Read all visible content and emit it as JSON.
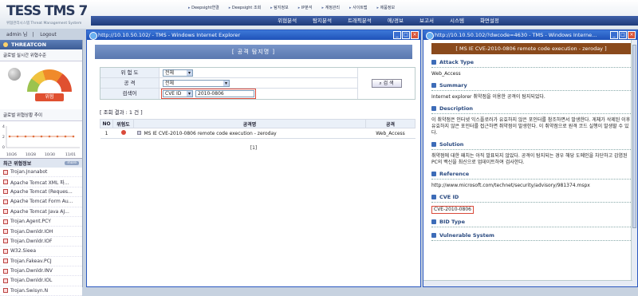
{
  "app": {
    "logo": "TESS TMS 7",
    "logo_sub": "위협관리시스템  Threat Management System",
    "top_links": [
      "Deepsight연결",
      "Deepsight 조회",
      "탐지정보",
      "IP분석",
      "계정관리",
      "사이트맵",
      "제품정보"
    ],
    "nav": [
      "위협분석",
      "탐지분석",
      "트래픽분석",
      "에/경보",
      "보고서",
      "시스템",
      "화면설정"
    ],
    "user": "admin 님",
    "logout": "Logout"
  },
  "left": {
    "title": "THREATCON",
    "realtime_label": "글로벌 실시간 위협수준",
    "gauge_label": "위험",
    "gauge_sub": "",
    "trend_label": "글로벌 위협상황 추이",
    "trend_dates": [
      "10/26",
      "10/28",
      "10/30",
      "11/01"
    ],
    "trend_yticks": [
      "4",
      "2",
      "0"
    ],
    "recent_title": "최근 위협정보",
    "more": "more",
    "recent": [
      "Trojan.Jnanabot",
      "Apache Tomcat XML 파...",
      "Apache Tomcat (Reques...",
      "Apache Tomcat Form Au...",
      "Apache Tomcat Java AJ...",
      "Trojan.Agent.PCY",
      "Trojan.Dwnldr.IOH",
      "Trojan.Dwnldr.IOF",
      "W32.Sieea",
      "Trojan.Fakeav.PCJ",
      "Trojan.Dwnldr.INV",
      "Trojan.Dwnldr.IOL",
      "Trojan.Swisyn.N"
    ]
  },
  "w1": {
    "title": "http://10.10.50.102/ - TMS - Windows Internet Explorer",
    "banner": "[ 공격 탐지명 ]",
    "lbl_sev": "위 험 도",
    "lbl_attack": "공 격",
    "lbl_keyword": "검색어",
    "sev_val": "전체",
    "attack_val": "전체",
    "kw_type": "CVE ID",
    "kw_val": "2010-0806",
    "search_btn": "검 색",
    "result_summary": "[ 조회 결과 : 1 건 ]",
    "cols": [
      "NO",
      "위험도",
      "공격명",
      "공격"
    ],
    "row": {
      "no": "1",
      "name": "MS IE CVE-2010-0806 remote code execution - zeroday",
      "attack": "Web_Access"
    },
    "pager": "[1]"
  },
  "w2": {
    "title": "http://10.10.50.102/?dwcode=4630 - TMS - Windows Interne...",
    "banner": "[ MS IE CVE-2010-0806 remote code execution - zeroday ]",
    "sections": [
      {
        "h": "Attack Type",
        "b": "Web_Access"
      },
      {
        "h": "Summary",
        "b": "Internet explorer 취약점을 이용한 공격이 탐지되었다."
      },
      {
        "h": "Description",
        "b": "이 취약점은 인터넷 익스플로러가 유효하지 않은 포인터를 참조하면서 발생한다. 게체가 삭제된 이후 유효하지 않은 포인터를 접근하면 취약점이 발생한다. 이 취약점으로 원격 코드 실행이 발생할 수 있다."
      },
      {
        "h": "Solution",
        "b": "취약점에 대한 패치는 아직 발표되지 않았다. 공격이 탐지되는 경우 해당 도메인을 차단하고 감염된 PC의 백신을 최신으로 업데이트하여 검사한다."
      },
      {
        "h": "Reference",
        "b": "http://www.microsoft.com/technet/security/advisory/981374.mspx"
      },
      {
        "h": "CVE ID",
        "b": "CVE-2010-0806"
      },
      {
        "h": "BID Type",
        "b": ""
      },
      {
        "h": "Vulnerable System",
        "b": ""
      }
    ]
  }
}
